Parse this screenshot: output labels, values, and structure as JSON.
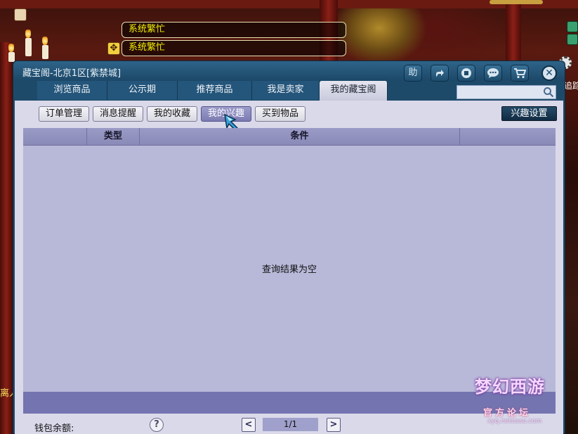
{
  "system_messages": [
    "系统繁忙",
    "系统繁忙"
  ],
  "side_text": {
    "right_top": "追踪",
    "left_bottom": "离人"
  },
  "window": {
    "title": "藏宝阁-北京1区[紫禁城]",
    "toolbar": {
      "help_label": "助",
      "icons": [
        "share-icon",
        "record-icon",
        "chat-icon",
        "cart-icon",
        "close-icon"
      ]
    },
    "tabs": [
      {
        "label": "浏览商品",
        "active": false
      },
      {
        "label": "公示期",
        "active": false
      },
      {
        "label": "推荐商品",
        "active": false
      },
      {
        "label": "我是卖家",
        "active": false
      },
      {
        "label": "我的藏宝阁",
        "active": true
      }
    ],
    "search": {
      "value": "",
      "placeholder": ""
    }
  },
  "subnav": {
    "buttons": [
      {
        "label": "订单管理",
        "active": false
      },
      {
        "label": "消息提醒",
        "active": false
      },
      {
        "label": "我的收藏",
        "active": false
      },
      {
        "label": "我的兴趣",
        "active": true
      },
      {
        "label": "买到物品",
        "active": false
      }
    ],
    "settings_label": "兴趣设置"
  },
  "table": {
    "columns": [
      "",
      "类型",
      "条件",
      ""
    ],
    "rows": [],
    "empty_message": "查询结果为空"
  },
  "footer": {
    "wallet_label": "钱包余额:",
    "help_label": "?",
    "prev_label": "<",
    "page_display": "1/1",
    "next_label": ">"
  },
  "watermark": {
    "title": "梦幻西游",
    "subtitle": "官方论坛",
    "url": "xyq.netease.com"
  },
  "colors": {
    "window_frame": "#1e4a6a",
    "panel_bg": "#dad9ea",
    "table_bg": "#b8b8d8",
    "table_header": "#9090c0",
    "active_subnav": "#8c8cc0",
    "system_text": "#f2f000"
  }
}
